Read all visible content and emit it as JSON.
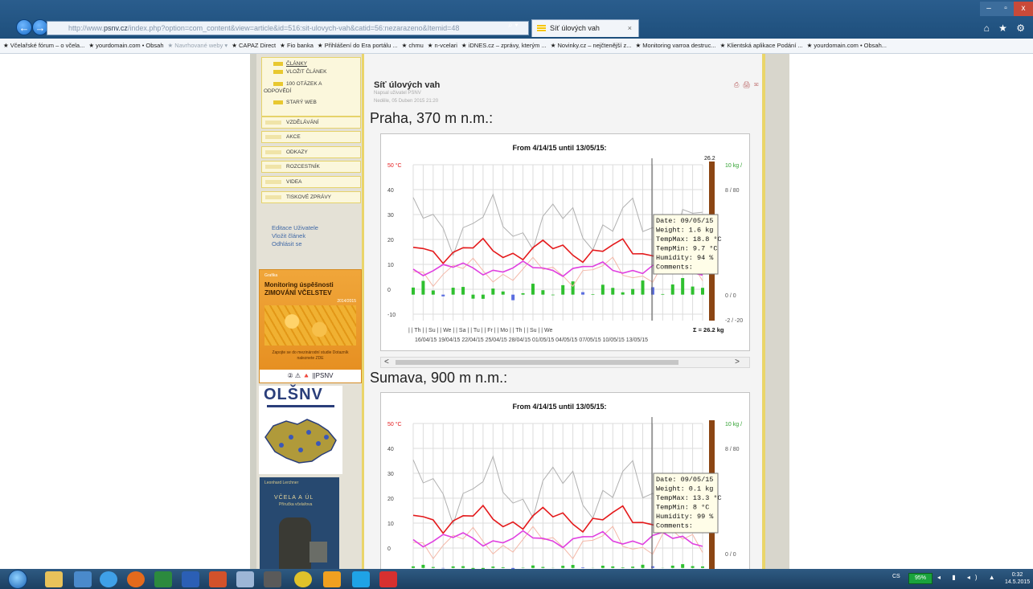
{
  "browser": {
    "address_prefix": "http://www.",
    "address_host": "psnv.cz",
    "address_path": "/index.php?option=com_content&view=article&id=516:sit-ulovych-vah&catid=56:nezarazeno&Itemid=48",
    "tab_title": "Síť úlových vah",
    "tab_close": "×",
    "win_min": "–",
    "win_max": "▫",
    "win_close": "x",
    "toolbar_icons": "⌂ ★ ⚙",
    "bookmarks": [
      "Včelařské fórum – o včela...",
      "yourdomain.com • Obsah",
      "Navrhované weby ▾",
      "CAPAZ Direct",
      "Fio banka",
      "Přihlášení do Era portálu ...",
      "chmu",
      "n-vcelari",
      "iDNES.cz – zprávy, kterým ...",
      "Novinky.cz – nejčtenější z...",
      "Monitoring varroa destruc...",
      "Klientská aplikace Podání ...",
      "yourdomain.com • Obsah..."
    ]
  },
  "nav": {
    "sub_items": [
      "ČLÁNKY",
      "VLOŽIT ČLÁNEK",
      "100 OTÁZEK A",
      "ODPOVĚDÍ",
      "STARÝ WEB"
    ],
    "menu_items": [
      "VZDĚLÁVÁNÍ",
      "AKCE",
      "ODKAZY",
      "ROZCESTNÍK",
      "VIDEA",
      "TISKOVÉ ZPRÁVY"
    ],
    "user_links": [
      "Editace Uživatele",
      "Vložit článek",
      "Odhlásit se"
    ],
    "promo_zimovani": {
      "top": "Grafika",
      "headline": "Monitoring úspěšnosti ZIMOVÁNÍ VČELSTEV",
      "years": "2014/2015",
      "cta": "Zapojte se do mezinárodní studie Dotazník naleznete ZDE",
      "footer": "② ⚠ 🔺 ||PSNV"
    },
    "promo_olsnv": {
      "logo": "OLŠNV"
    },
    "promo_book": {
      "author": "Leonhard Lerchner",
      "title": "VČELA A ÚL",
      "subtitle": "Příručka včelařova"
    }
  },
  "article": {
    "title": "Síť úlových vah",
    "meta_author": "Napsal uživatel PSNV",
    "meta_date": "Neděle, 05 Duben 2015 21:20",
    "icons": "⎙ 🖨 ✉"
  },
  "charts": [
    {
      "station": "Praha, 370 m n.m.:",
      "title": "From 4/14/15 until 13/05/15:",
      "left_ticks": [
        "50 °C",
        "40",
        "30",
        "20",
        "10",
        "0",
        "-10"
      ],
      "right_ticks": [
        "10 kg /",
        "8 / 80",
        "0 / 0",
        "-2 / -20"
      ],
      "top_value": "26.2",
      "dow_labels": "|  | Th |  | Su |  | We |  | Sa |  | Tu |  | Fr |  | Mo |  | Th |  | Su |  | We",
      "sum_label": "Σ = 26.2 kg",
      "date_labels": "16/04/15 19/04/15 22/04/15 25/04/15 28/04/15 01/05/15 04/05/15 07/05/15 10/05/15 13/05/15",
      "tooltip": [
        "Date: 09/05/15",
        "Weight: 1.6 kg",
        "TempMax: 18.8 °C",
        "TempMin: 9.7 °C",
        "Humidity: 94 %",
        "Comments:"
      ]
    },
    {
      "station": "Sumava, 900 m n.m.:",
      "title": "From 4/14/15 until 13/05/15:",
      "left_ticks": [
        "50 °C",
        "40",
        "30",
        "20",
        "10",
        "0"
      ],
      "right_ticks": [
        "10 kg /",
        "8 / 80",
        "0 / 0"
      ],
      "tooltip": [
        "Date: 09/05/15",
        "Weight: 0.1 kg",
        "TempMax: 13.3 °C",
        "TempMin: 8 °C",
        "Humidity: 99 %",
        "Comments:"
      ]
    }
  ],
  "scroll": {
    "left": "<",
    "right": ">"
  },
  "taskbar": {
    "lang": "CS",
    "battery": "95%",
    "tray": "◂ ▮ ◂) ▲",
    "time": "0:32",
    "date": "14.5.2015"
  },
  "colors": {
    "max_temp": "#e41a1c",
    "min_temp": "#e040e0",
    "humidity": "#b0b0b0",
    "dew": "#f4b8a8",
    "gain": "#2fc02f",
    "loss": "#5b6ee0",
    "total": "#8b4513"
  }
}
